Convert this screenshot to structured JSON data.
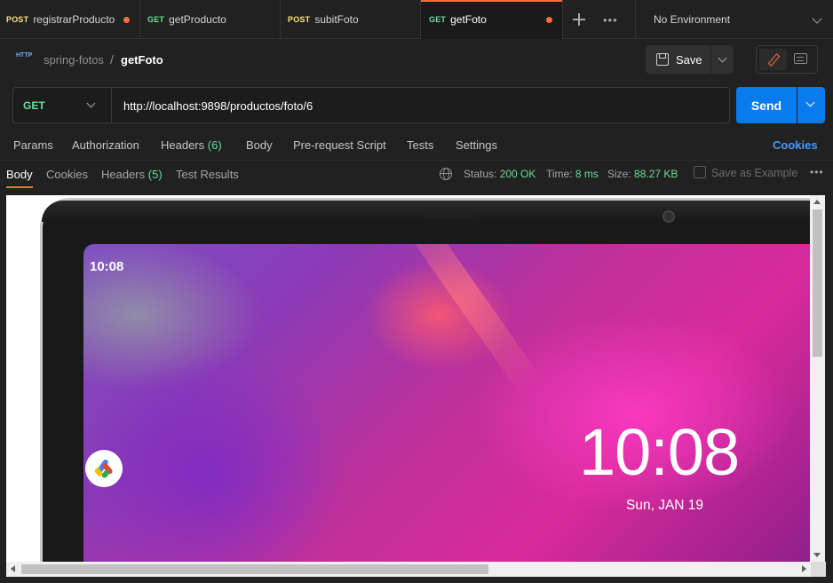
{
  "colors": {
    "background": "#212121",
    "accent": "#ff6c37",
    "get_method": "#6bdd9a",
    "post_method": "#ffe47e",
    "send_button": "#097bed",
    "cookies_link": "#3f9dff"
  },
  "tabs": [
    {
      "method": "POST",
      "name": "registrarProducto",
      "unsaved": true
    },
    {
      "method": "GET",
      "name": "getProducto",
      "unsaved": false
    },
    {
      "method": "POST",
      "name": "subitFoto",
      "unsaved": false
    },
    {
      "method": "GET",
      "name": "getFoto",
      "unsaved": true,
      "active": true
    }
  ],
  "environment": {
    "label": "No Environment"
  },
  "breadcrumb": {
    "icon": "http-icon",
    "icon_text": "HTTP",
    "collection": "spring-fotos",
    "separator": "/",
    "request": "getFoto"
  },
  "toolbar": {
    "save_label": "Save"
  },
  "request": {
    "method": "GET",
    "url": "http://localhost:9898/productos/foto/6",
    "send_label": "Send"
  },
  "request_tabs": [
    {
      "label": "Params",
      "count": ""
    },
    {
      "label": "Authorization",
      "count": ""
    },
    {
      "label": "Headers",
      "count": "(6)"
    },
    {
      "label": "Body",
      "count": ""
    },
    {
      "label": "Pre-request Script",
      "count": ""
    },
    {
      "label": "Tests",
      "count": ""
    },
    {
      "label": "Settings",
      "count": ""
    }
  ],
  "cookies_label": "Cookies",
  "response_tabs": [
    {
      "label": "Body",
      "count": "",
      "active": true
    },
    {
      "label": "Cookies",
      "count": ""
    },
    {
      "label": "Headers",
      "count": "(5)"
    },
    {
      "label": "Test Results",
      "count": ""
    }
  ],
  "response_status": {
    "status_label": "Status:",
    "status_value": "200 OK",
    "time_label": "Time:",
    "time_value": "8 ms",
    "size_label": "Size:",
    "size_value": "88.27 KB",
    "save_example_label": "Save as Example"
  },
  "response_image": {
    "status_bar_time": "10:08",
    "lock_time": "10:08",
    "lock_date": "Sun, JAN 19"
  }
}
